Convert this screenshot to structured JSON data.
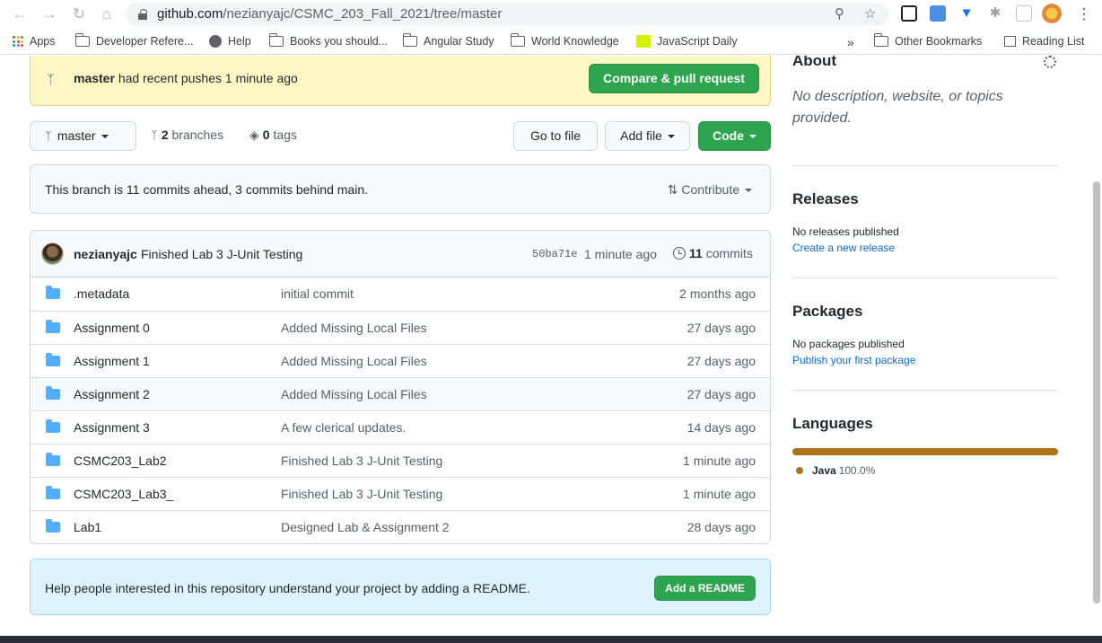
{
  "browser": {
    "url_host": "github.com",
    "url_path": "/nezianyajc/CSMC_203_Fall_2021/tree/master",
    "bookmarks": [
      {
        "label": "Apps"
      },
      {
        "label": "Developer Refere..."
      },
      {
        "label": "Help"
      },
      {
        "label": "Books you should..."
      },
      {
        "label": "Angular Study"
      },
      {
        "label": "World Knowledge"
      },
      {
        "label": "JavaScript Daily"
      }
    ],
    "overflow": "»",
    "other_bookmarks": "Other Bookmarks",
    "reading_list": "Reading List"
  },
  "push_banner": {
    "branch": "master",
    "message": "had recent pushes 1 minute ago",
    "button": "Compare & pull request"
  },
  "toolbar": {
    "branch_select": "master",
    "branches_count": "2",
    "branches_label": "branches",
    "tags_count": "0",
    "tags_label": "tags",
    "go_to_file": "Go to file",
    "add_file": "Add file",
    "code": "Code"
  },
  "ahead_box": {
    "text": "This branch is 11 commits ahead, 3 commits behind main.",
    "contribute": "Contribute"
  },
  "latest_commit": {
    "author": "nezianyajc",
    "message": "Finished Lab 3 J-Unit Testing",
    "sha": "50ba71e",
    "time": "1 minute ago",
    "commits_count": "11",
    "commits_label": "commits"
  },
  "files": [
    {
      "name": ".metadata",
      "message": "initial commit",
      "age": "2 months ago"
    },
    {
      "name": "Assignment 0",
      "message": "Added Missing Local Files",
      "age": "27 days ago"
    },
    {
      "name": "Assignment 1",
      "message": "Added Missing Local Files",
      "age": "27 days ago"
    },
    {
      "name": "Assignment 2",
      "message": "Added Missing Local Files",
      "age": "27 days ago"
    },
    {
      "name": "Assignment 3",
      "message": "A few clerical updates.",
      "age": "14 days ago"
    },
    {
      "name": "CSMC203_Lab2",
      "message": "Finished Lab 3 J-Unit Testing",
      "age": "1 minute ago"
    },
    {
      "name": "CSMC203_Lab3_",
      "message": "Finished Lab 3 J-Unit Testing",
      "age": "1 minute ago"
    },
    {
      "name": "Lab1",
      "message": "Designed Lab & Assignment 2",
      "age": "28 days ago"
    }
  ],
  "readme": {
    "text": "Help people interested in this repository understand your project by adding a README.",
    "button": "Add a README"
  },
  "sidebar": {
    "about_heading": "About",
    "about_desc": "No description, website, or topics provided.",
    "releases_heading": "Releases",
    "releases_none": "No releases published",
    "releases_link": "Create a new release",
    "packages_heading": "Packages",
    "packages_none": "No packages published",
    "packages_link": "Publish your first package",
    "languages_heading": "Languages",
    "language_name": "Java",
    "language_pct": "100.0%",
    "language_color": "#b07219"
  },
  "colors": {
    "accent_green": "#2da44e",
    "link_blue": "#0969da",
    "folder_blue": "#54aeff",
    "banner_yellow": "#fff8c5",
    "readme_blue": "#ddf4ff"
  }
}
